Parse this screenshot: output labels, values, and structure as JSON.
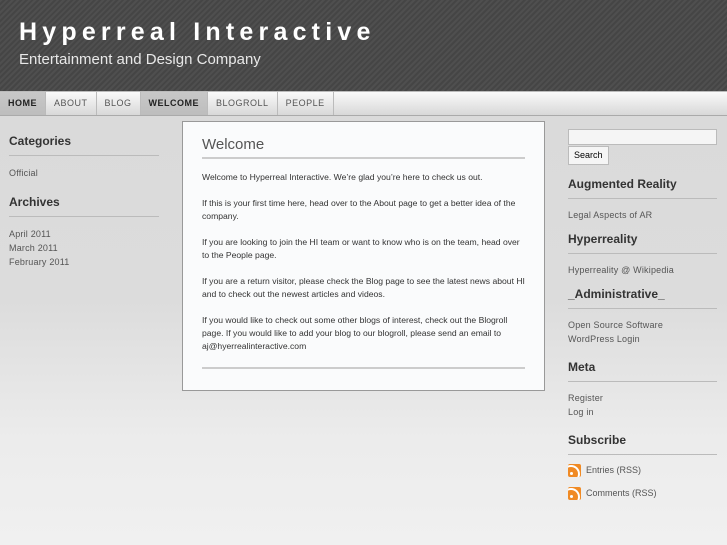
{
  "header": {
    "title": "Hyperreal Interactive",
    "tagline": "Entertainment and Design Company"
  },
  "nav": [
    "HOME",
    "ABOUT",
    "BLOG",
    "WELCOME",
    "BLOGROLL",
    "PEOPLE"
  ],
  "left": {
    "categories_title": "Categories",
    "categories": [
      "Official"
    ],
    "archives_title": "Archives",
    "archives": [
      "April 2011",
      "March 2011",
      "February 2011"
    ]
  },
  "content": {
    "title": "Welcome",
    "paragraphs": [
      "Welcome to Hyperreal Interactive. We’re glad you’re here to check us out.",
      "If this is your first time here, head over to the About page to get a better idea of the company.",
      "If you are looking to join the HI team or want to know who is on the team, head over to the People page.",
      "If you are a return visitor, please check the Blog page to see the latest news about HI and to check out the newest articles and videos.",
      "If you would like to check out some other blogs of interest, check out the Blogroll page. If you would like to add your blog to our blogroll, please send an email to aj@hyerrealinteractive.com"
    ]
  },
  "right": {
    "search_value": "",
    "search_button": "Search",
    "ar_title": "Augmented Reality",
    "ar_links": [
      "Legal Aspects of AR"
    ],
    "hr_title": "Hyperreality",
    "hr_links": [
      "Hyperreality @ Wikipedia"
    ],
    "admin_title": "_Administrative_",
    "admin_links": [
      "Open Source Software",
      "WordPress Login"
    ],
    "meta_title": "Meta",
    "meta_links": [
      "Register",
      "Log in"
    ],
    "sub_title": "Subscribe",
    "sub_links": [
      "Entries (RSS)",
      "Comments (RSS)"
    ]
  }
}
